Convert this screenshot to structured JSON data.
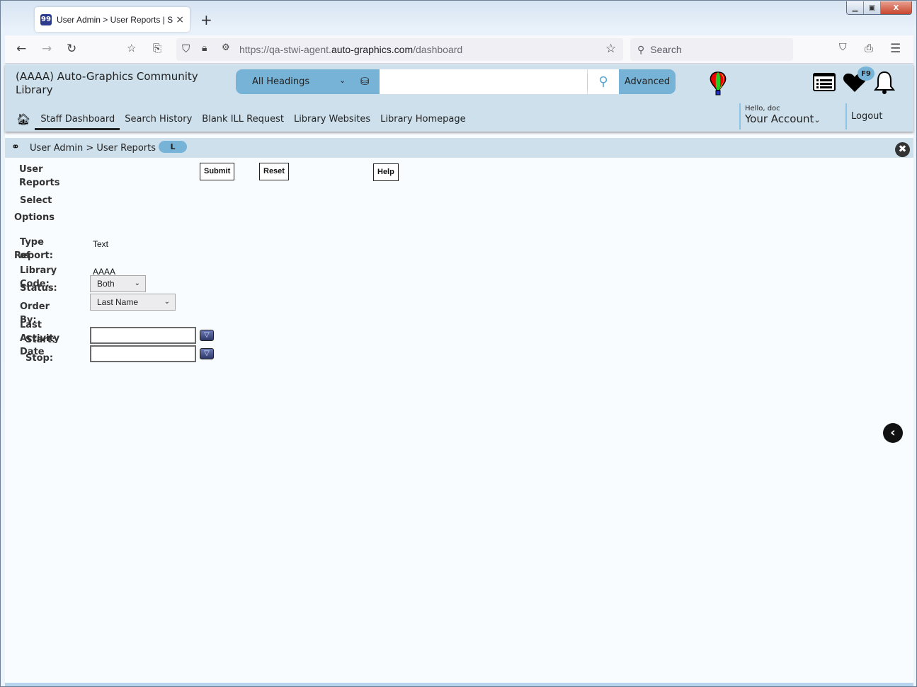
{
  "browser": {
    "tab_title": "User Admin > User Reports | STWI",
    "tab_favicon": "99",
    "url_prefix": "https://qa-stwi-agent.",
    "url_domain": "auto-graphics.com",
    "url_path": "/dashboard",
    "search_placeholder": "Search",
    "new_tab": "+",
    "tab_close": "×"
  },
  "header": {
    "library_name": "(AAAA) Auto-Graphics Community Library",
    "search_scope": "All Headings",
    "search_value": "",
    "advanced_label": "Advanced",
    "f9_badge": "F9",
    "greeting": "Hello, doc",
    "account_label": "Your Account",
    "logout_label": "Logout"
  },
  "nav": {
    "items": [
      {
        "label": "Staff Dashboard",
        "active": true
      },
      {
        "label": "Search History"
      },
      {
        "label": "Blank ILL Request"
      },
      {
        "label": "Library Websites"
      },
      {
        "label": "Library Homepage"
      }
    ]
  },
  "breadcrumb": {
    "text": "User Admin > User Reports",
    "badge": "L"
  },
  "form": {
    "title": "User Reports",
    "submit_label": "Submit",
    "reset_label": "Reset",
    "help_label": "Help",
    "select_line1": "Select",
    "select_line2": "Options",
    "type_line1": "Type of",
    "type_line2": "Report:",
    "type_value": "Text",
    "library_code_label": "Library Code:",
    "library_code_value": "AAAA",
    "status_label": "Status:",
    "status_value": "Both",
    "order_by_label": "Order By:",
    "order_by_value": "Last Name",
    "last_activity_label": "Last Activity Date",
    "start_label": "Start:",
    "start_value": "",
    "stop_label": "Stop:",
    "stop_value": ""
  }
}
